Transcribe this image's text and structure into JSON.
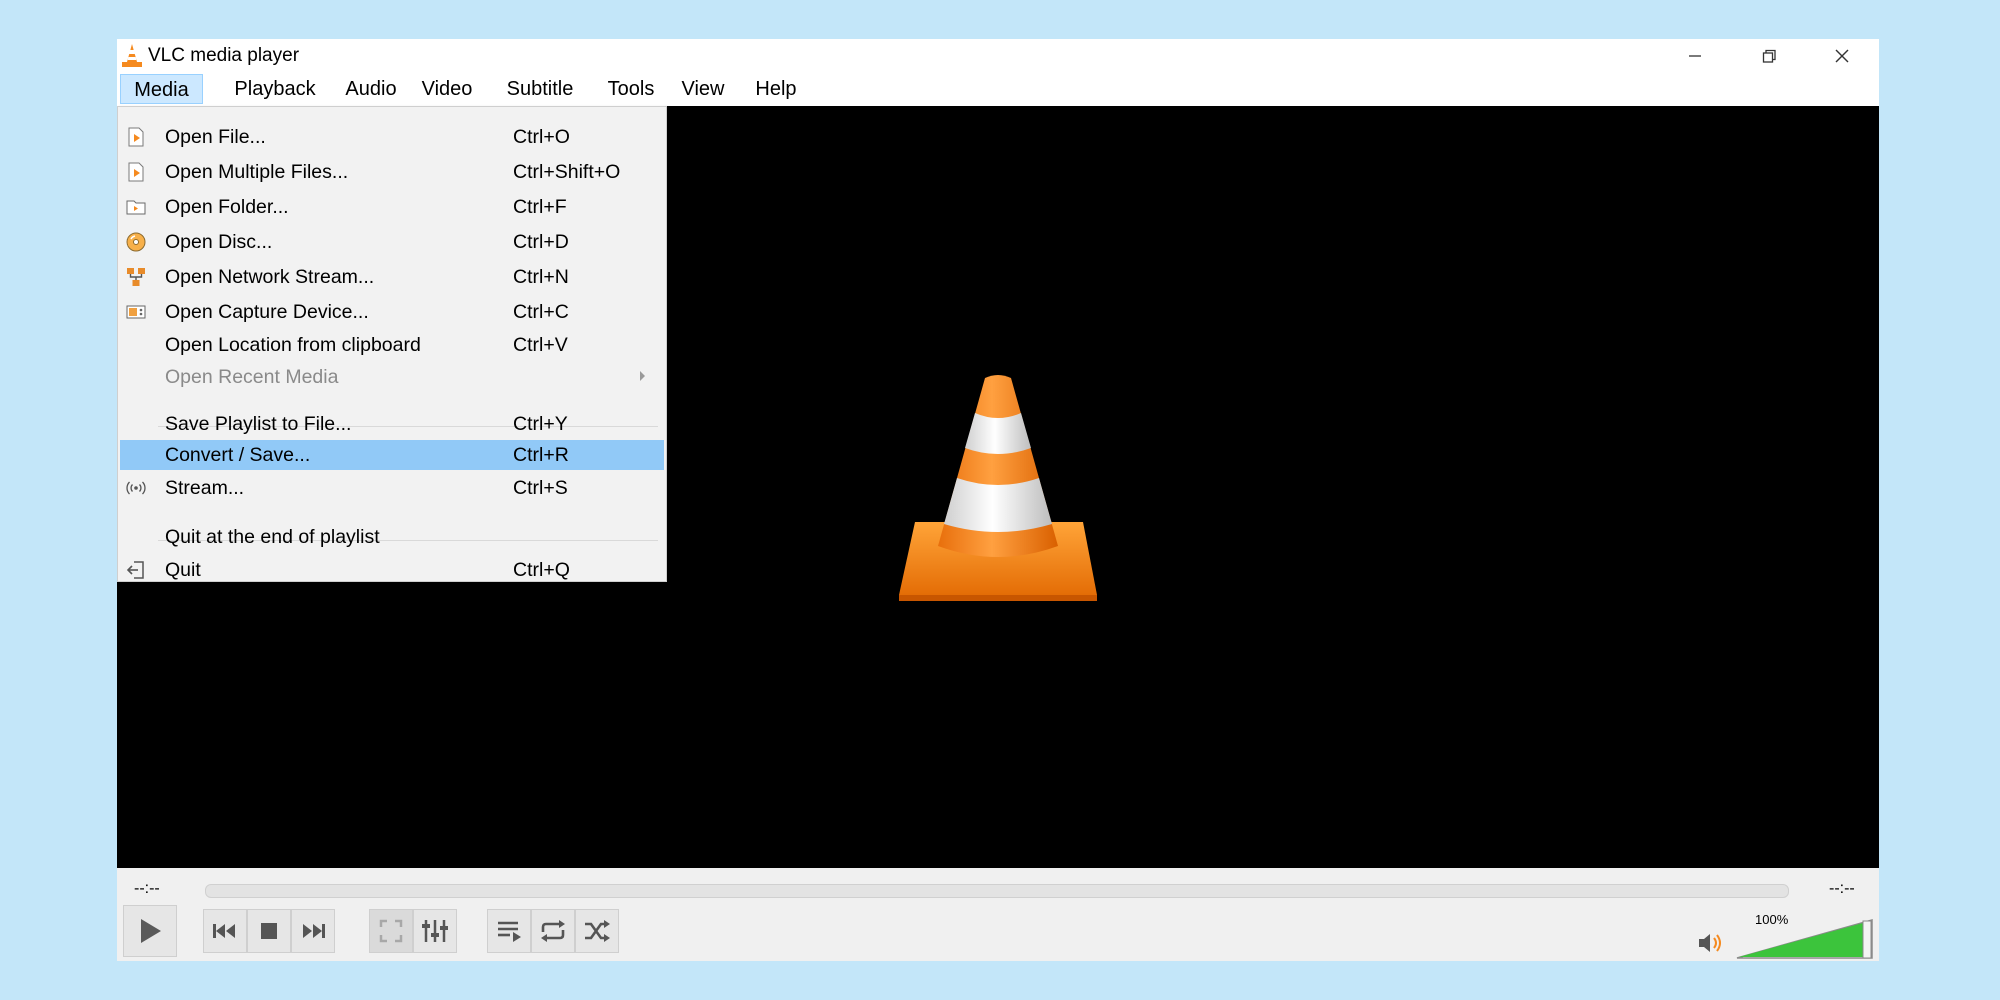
{
  "window": {
    "title": "VLC media player",
    "controls": [
      "minimize-icon",
      "restore-icon",
      "close-icon"
    ]
  },
  "menubar": {
    "items": [
      "Media",
      "Playback",
      "Audio",
      "Video",
      "Subtitle",
      "Tools",
      "View",
      "Help"
    ],
    "active": "Media"
  },
  "media_menu": {
    "items": [
      {
        "label": "Open File...",
        "shortcut": "Ctrl+O",
        "icon": "file-icon"
      },
      {
        "label": "Open Multiple Files...",
        "shortcut": "Ctrl+Shift+O",
        "icon": "files-icon"
      },
      {
        "label": "Open Folder...",
        "shortcut": "Ctrl+F",
        "icon": "folder-icon"
      },
      {
        "label": "Open Disc...",
        "shortcut": "Ctrl+D",
        "icon": "disc-icon"
      },
      {
        "label": "Open Network Stream...",
        "shortcut": "Ctrl+N",
        "icon": "network-icon"
      },
      {
        "label": "Open Capture Device...",
        "shortcut": "Ctrl+C",
        "icon": "capture-icon"
      },
      {
        "label": "Open Location from clipboard",
        "shortcut": "Ctrl+V",
        "icon": ""
      },
      {
        "label": "Open Recent Media",
        "shortcut": "",
        "icon": "",
        "disabled": true,
        "submenu": true
      },
      {
        "label": "Save Playlist to File...",
        "shortcut": "Ctrl+Y",
        "icon": ""
      },
      {
        "label": "Convert / Save...",
        "shortcut": "Ctrl+R",
        "icon": "",
        "highlighted": true
      },
      {
        "label": "Stream...",
        "shortcut": "Ctrl+S",
        "icon": "stream-icon"
      },
      {
        "label": "Quit at the end of playlist",
        "shortcut": "",
        "icon": ""
      },
      {
        "label": "Quit",
        "shortcut": "Ctrl+Q",
        "icon": "quit-icon"
      }
    ]
  },
  "player": {
    "elapsed": "--:--",
    "remaining": "--:--",
    "volume": "100%",
    "volume_level": 1.0,
    "buttons": [
      "play-icon",
      "previous-icon",
      "stop-icon",
      "next-icon",
      "fullscreen-icon",
      "extended-settings-icon",
      "playlist-icon",
      "loop-icon",
      "shuffle-icon"
    ]
  },
  "colors": {
    "accent_highlight": "#91c9f7",
    "menu_active": "#cce8ff",
    "cone_orange": "#f58a1f",
    "volume_green": "#3cc43c",
    "background": "#c3e6f9"
  }
}
